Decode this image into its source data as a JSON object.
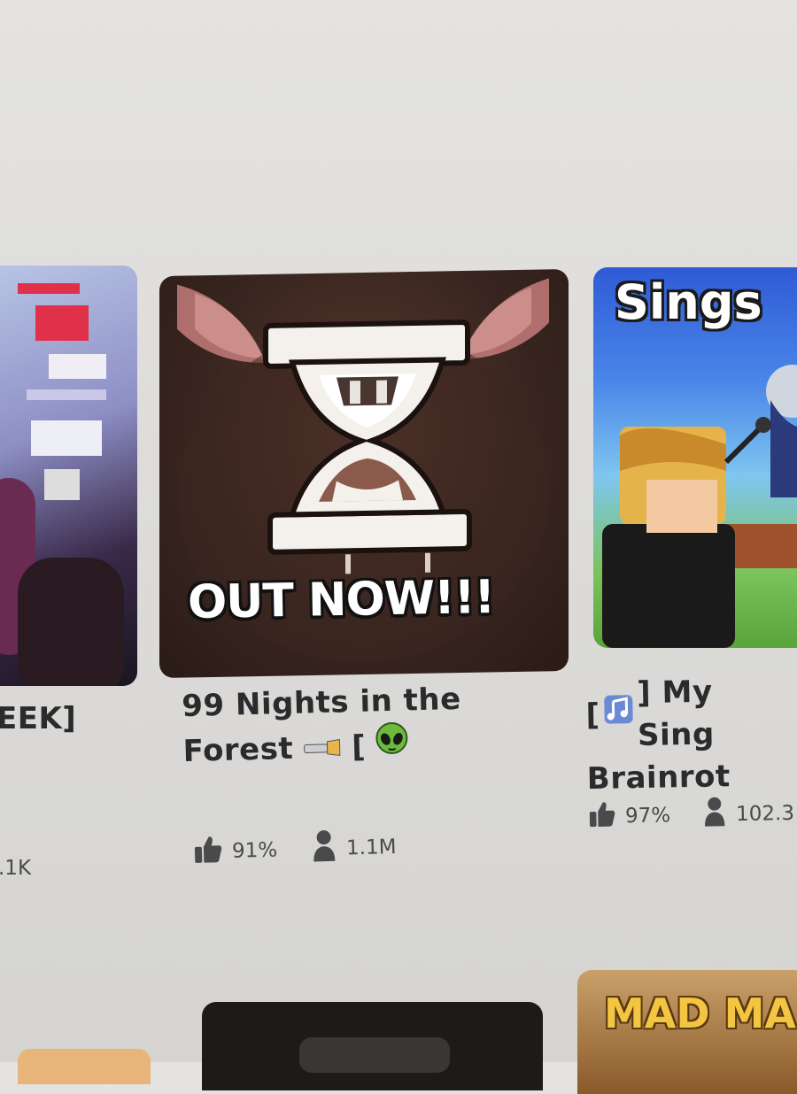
{
  "cards": [
    {
      "id": "left",
      "title_tail": "EEK]",
      "players": ".1K"
    },
    {
      "id": "center",
      "thumbnail_text": "OUT NOW!!!",
      "title_line1": "99 Nights in the",
      "title_line2": "Forest",
      "title_suffix_icons": [
        "flashlight-icon",
        "bracket",
        "alien-emoji-icon"
      ],
      "title_bracket": "[",
      "rating": "91%",
      "players": "1.1M"
    },
    {
      "id": "right",
      "thumbnail_text": "Sings",
      "title_line1_prefix": "[",
      "title_line1_suffix": "] My Sing",
      "title_line2": "Brainrot",
      "rating": "97%",
      "players": "102.3"
    }
  ],
  "bottom_row": {
    "right_thumbnail_text": "MAD MA"
  },
  "colors": {
    "page_bg": "#e0dfdd",
    "title_text": "#2b2b2d",
    "stat_text": "#4a4a4c"
  }
}
